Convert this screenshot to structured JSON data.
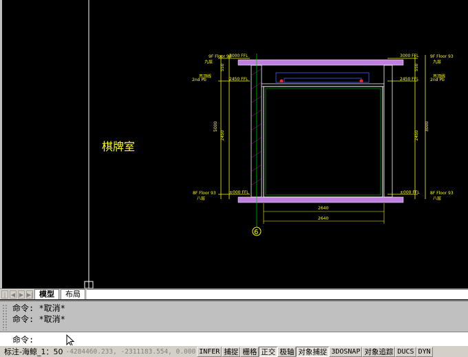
{
  "drawing": {
    "room_label": "棋牌室",
    "axis_label": "6",
    "left_marks": [
      {
        "floor": "9F Floor 93",
        "level": "九层"
      },
      {
        "floor": "2nd Pb",
        "level": "吊顶线"
      },
      {
        "floor": "8F Floor 93",
        "level": "八层"
      }
    ],
    "right_marks": [
      {
        "floor": "9F Floor 93",
        "level": "九层"
      },
      {
        "floor": "2nd Pb",
        "level": "吊顶线"
      },
      {
        "floor": "8F Floor 93",
        "level": "八层"
      }
    ],
    "left_dims": [
      "550",
      "5000",
      "2450"
    ],
    "right_dims": [
      "550",
      "3000",
      "2450"
    ],
    "elev_labels": [
      "3000 FFL",
      "2450 FFL",
      "±000 FFL"
    ],
    "bottom_dims": [
      "2640",
      "2640"
    ]
  },
  "layout_tabs": {
    "nav_buttons": [
      "|◀",
      "◀",
      "▶",
      "▶|"
    ],
    "tabs": [
      {
        "label": "模型",
        "active": true
      },
      {
        "label": "布局",
        "active": false
      }
    ]
  },
  "command": {
    "history": [
      "命令: *取消*",
      "命令: *取消*"
    ],
    "prompt": "命令:",
    "input_value": ""
  },
  "status": {
    "scale": "标注-海鲸_1：50",
    "coordinates": "-4284460.233, -2311183.554, 0.000",
    "buttons": [
      {
        "label": "INFER",
        "on": false,
        "mono": true
      },
      {
        "label": "捕捉",
        "on": false,
        "mono": false
      },
      {
        "label": "栅格",
        "on": false,
        "mono": false
      },
      {
        "label": "正交",
        "on": true,
        "mono": false
      },
      {
        "label": "极轴",
        "on": false,
        "mono": false
      },
      {
        "label": "对象捕捉",
        "on": true,
        "mono": false
      },
      {
        "label": "3DOSNAP",
        "on": false,
        "mono": true
      },
      {
        "label": "对象追踪",
        "on": false,
        "mono": false
      },
      {
        "label": "DUCS",
        "on": false,
        "mono": true
      },
      {
        "label": "DYN",
        "on": false,
        "mono": true
      }
    ]
  },
  "colors": {
    "drawing_bg": "#000000",
    "text_yellow": "#ffff00",
    "slab_purple": "#c080e0",
    "wall_white": "#ffffff",
    "green_line": "#00c000"
  }
}
